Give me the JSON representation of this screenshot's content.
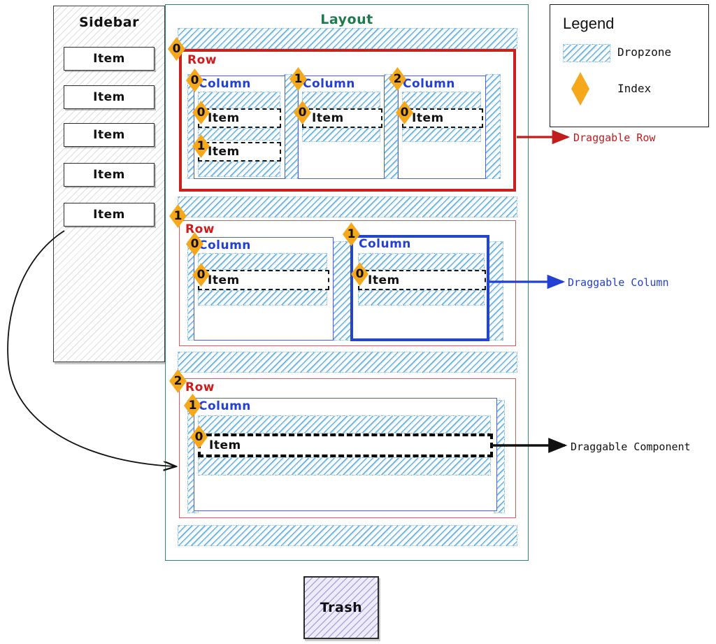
{
  "sidebar": {
    "title": "Sidebar",
    "items": [
      {
        "label": "Item"
      },
      {
        "label": "Item"
      },
      {
        "label": "Item"
      },
      {
        "label": "Item"
      },
      {
        "label": "Item"
      }
    ]
  },
  "layout": {
    "title": "Layout",
    "row_label": "Row",
    "column_label": "Column",
    "item_label": "Item",
    "rows": [
      {
        "index": "0",
        "highlighted": true,
        "columns": [
          {
            "index": "0",
            "items": [
              {
                "index": "0"
              },
              {
                "index": "1"
              }
            ]
          },
          {
            "index": "1",
            "items": [
              {
                "index": "0"
              }
            ]
          },
          {
            "index": "2",
            "items": [
              {
                "index": "0"
              }
            ]
          }
        ]
      },
      {
        "index": "1",
        "highlighted": false,
        "columns": [
          {
            "index": "0",
            "items": [
              {
                "index": "0"
              }
            ]
          },
          {
            "index": "1",
            "highlighted": true,
            "items": [
              {
                "index": "0"
              }
            ]
          }
        ]
      },
      {
        "index": "2",
        "highlighted": false,
        "columns": [
          {
            "index": "1",
            "items": [
              {
                "index": "0",
                "highlighted": true
              }
            ]
          }
        ]
      }
    ]
  },
  "legend": {
    "title": "Legend",
    "dropzone_label": "Dropzone",
    "index_label": "Index"
  },
  "annotations": {
    "draggable_row": "Draggable Row",
    "draggable_column": "Draggable Column",
    "draggable_component": "Draggable Component"
  },
  "trash": {
    "label": "Trash"
  },
  "colors": {
    "row": "#d01b1b",
    "row_highlight": "#cc2020",
    "column": "#2340d6",
    "column_highlight": "#2445c8",
    "layout": "#1f7a4d",
    "index": "#F5A81C",
    "dropzone": "#8fc6e8",
    "component": "#000000",
    "trash_fill": "#eeecfb"
  }
}
